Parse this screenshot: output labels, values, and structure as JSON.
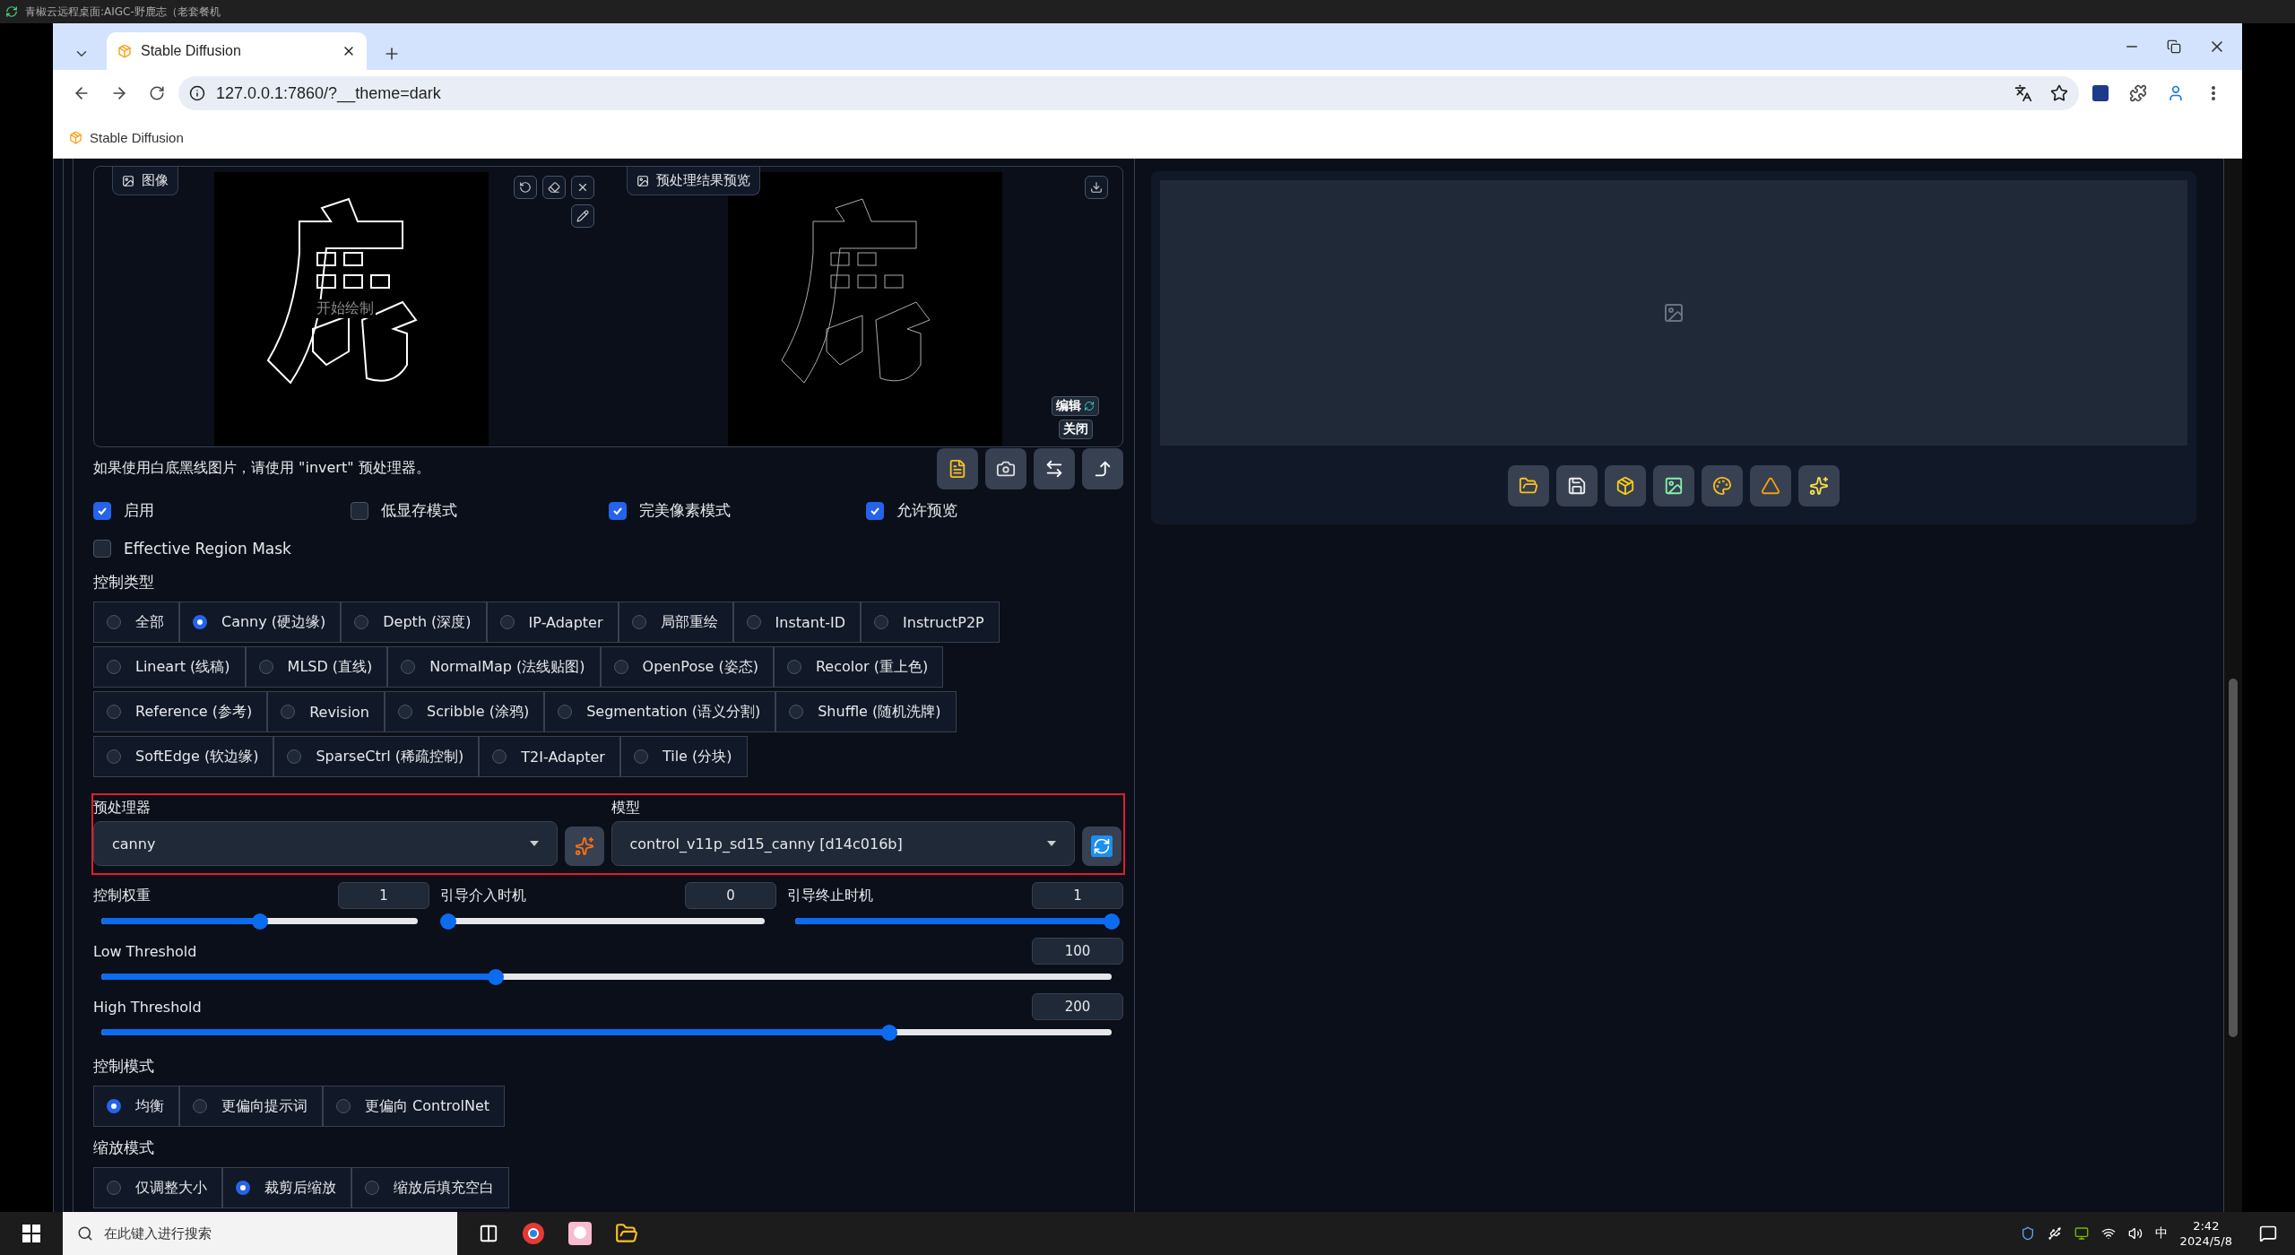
{
  "remote_title": "青椒云远程桌面:AIGC-野鹿志（老套餐机",
  "browser": {
    "tab_title": "Stable Diffusion",
    "url": "127.0.0.1:7860/?__theme=dark",
    "bookmark": "Stable Diffusion"
  },
  "image_input": {
    "label": "图像",
    "hint": "开始绘制"
  },
  "preview": {
    "label": "预处理结果预览",
    "edit": "编辑",
    "close": "关闭"
  },
  "hint": "如果使用白底黑线图片，请使用 \"invert\" 预处理器。",
  "checkboxes": [
    {
      "label": "启用",
      "checked": true
    },
    {
      "label": "低显存模式",
      "checked": false
    },
    {
      "label": "完美像素模式",
      "checked": true
    },
    {
      "label": "允许预览",
      "checked": true
    }
  ],
  "region_mask": {
    "label": "Effective Region Mask",
    "checked": false
  },
  "control_type": {
    "label": "控制类型",
    "rows": [
      {
        "options": [
          {
            "label": "全部",
            "selected": false
          },
          {
            "label": "Canny (硬边缘)",
            "selected": true
          },
          {
            "label": "Depth (深度)",
            "selected": false
          },
          {
            "label": "IP-Adapter",
            "selected": false
          },
          {
            "label": "局部重绘",
            "selected": false
          },
          {
            "label": "Instant-ID",
            "selected": false
          },
          {
            "label": "InstructP2P",
            "selected": false
          }
        ]
      },
      {
        "options": [
          {
            "label": "Lineart (线稿)",
            "selected": false
          },
          {
            "label": "MLSD (直线)",
            "selected": false
          },
          {
            "label": "NormalMap (法线贴图)",
            "selected": false
          },
          {
            "label": "OpenPose (姿态)",
            "selected": false
          },
          {
            "label": "Recolor (重上色)",
            "selected": false
          }
        ]
      },
      {
        "options": [
          {
            "label": "Reference (参考)",
            "selected": false
          },
          {
            "label": "Revision",
            "selected": false
          },
          {
            "label": "Scribble (涂鸦)",
            "selected": false
          },
          {
            "label": "Segmentation (语义分割)",
            "selected": false
          },
          {
            "label": "Shuffle (随机洗牌)",
            "selected": false
          }
        ]
      },
      {
        "options": [
          {
            "label": "SoftEdge (软边缘)",
            "selected": false
          },
          {
            "label": "SparseCtrl (稀疏控制)",
            "selected": false
          },
          {
            "label": "T2I-Adapter",
            "selected": false
          },
          {
            "label": "Tile (分块)",
            "selected": false
          }
        ]
      }
    ]
  },
  "preprocessor": {
    "label": "预处理器",
    "value": "canny"
  },
  "model": {
    "label": "模型",
    "value": "control_v11p_sd15_canny [d14c016b]"
  },
  "sliders": [
    {
      "kind": "third",
      "label": "控制权重",
      "value": "1",
      "level": 0.5
    },
    {
      "kind": "third",
      "label": "引导介入时机",
      "value": "0",
      "level": 0
    },
    {
      "kind": "third",
      "label": "引导终止时机",
      "value": "1",
      "level": 1
    },
    {
      "kind": "full",
      "label": "Low Threshold",
      "value": "100",
      "level": 0.39
    },
    {
      "kind": "full",
      "label": "High Threshold",
      "value": "200",
      "level": 0.78
    }
  ],
  "control_mode": {
    "label": "控制模式",
    "options": [
      {
        "label": "均衡",
        "selected": true
      },
      {
        "label": "更偏向提示词",
        "selected": false
      },
      {
        "label": "更偏向 ControlNet",
        "selected": false
      }
    ]
  },
  "resize_mode": {
    "label": "缩放模式",
    "options": [
      {
        "label": "仅调整大小",
        "selected": false
      },
      {
        "label": "裁剪后缩放",
        "selected": true
      },
      {
        "label": "缩放后填充空白",
        "selected": false
      }
    ]
  },
  "taskbar": {
    "search": "在此键入进行搜索",
    "ime": "中",
    "time": "2:42",
    "date": "2024/5/8"
  }
}
